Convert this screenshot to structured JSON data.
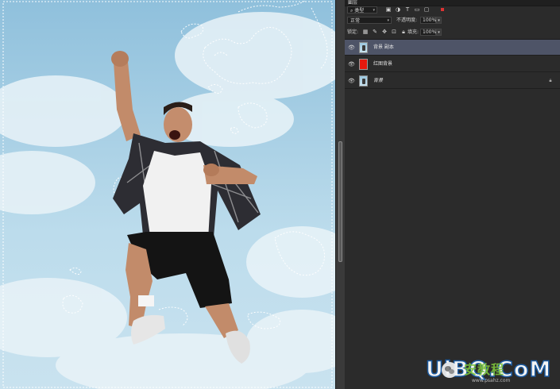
{
  "panel": {
    "tab_title": "图层",
    "filter": {
      "kind_label": "类型"
    },
    "blend_mode": "正常",
    "opacity_label": "不透明度:",
    "opacity_value": "100%",
    "lock_label": "锁定:",
    "fill_label": "填充:",
    "fill_value": "100%",
    "layers": [
      {
        "name": "背景 副本",
        "thumb": "photo",
        "selected": true,
        "italic": false,
        "locked": false,
        "visible": true
      },
      {
        "name": "红图背景",
        "thumb": "red",
        "selected": false,
        "italic": false,
        "locked": false,
        "visible": true
      },
      {
        "name": "背景",
        "thumb": "photo",
        "selected": false,
        "italic": true,
        "locked": true,
        "visible": true
      }
    ]
  },
  "colors": {
    "panel_bg": "#2b2b2b",
    "selection": "#4e5467",
    "red_layer": "#e5180e",
    "sky": "#a9d0e5"
  },
  "icons": {
    "filter_icons": [
      "image-filter-icon",
      "adjustment-filter-icon",
      "text-filter-icon",
      "shape-filter-icon",
      "smart-object-filter-icon"
    ],
    "lock_icons": [
      "lock-transparent-icon",
      "lock-paint-icon",
      "lock-position-icon",
      "lock-artboard-icon",
      "lock-all-icon"
    ]
  },
  "watermark": {
    "logo": "UiBQ.CoM",
    "chinese": "安教程",
    "url": "www.psahz.com"
  }
}
